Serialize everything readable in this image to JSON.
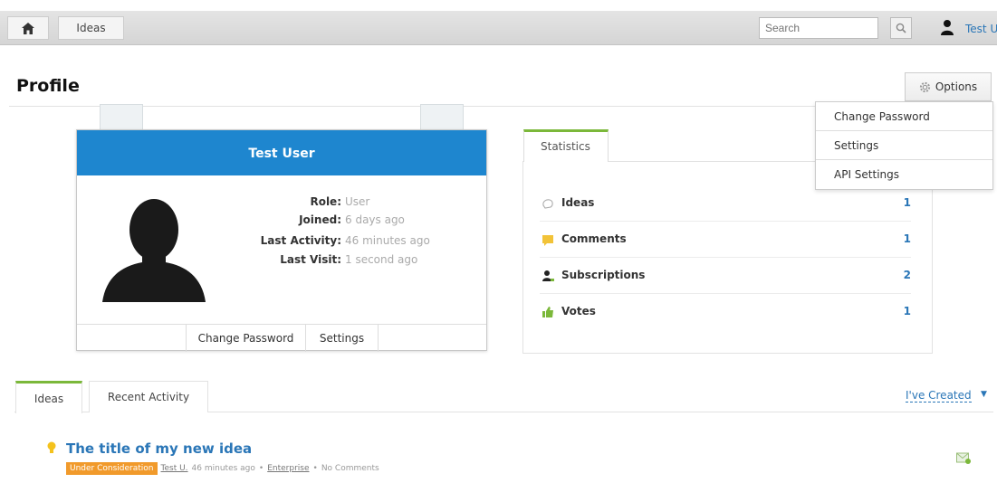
{
  "topbar": {
    "home_icon": "home-icon",
    "breadcrumb": "Ideas",
    "search_placeholder": "Search",
    "search_icon": "magnifier-icon",
    "user_icon": "user-silhouette-icon",
    "user_name": "Test U"
  },
  "page": {
    "title": "Profile",
    "options_label": "Options",
    "options_icon": "gear-icon",
    "dropdown": [
      "Change Password",
      "Settings",
      "API Settings"
    ]
  },
  "profile": {
    "name": "Test User",
    "fields": [
      {
        "label": "Role:",
        "value": "User"
      },
      {
        "label": "Joined:",
        "value": "6 days ago"
      },
      {
        "label": "Last Activity:",
        "value": "46 minutes ago"
      },
      {
        "label": "Last Visit:",
        "value": "1 second ago"
      }
    ],
    "buttons": [
      "Change Password",
      "Settings"
    ]
  },
  "statistics": {
    "tab_label": "Statistics",
    "rows": [
      {
        "icon": "bulb-outline-icon",
        "label": "Ideas",
        "value": "1"
      },
      {
        "icon": "comment-icon",
        "label": "Comments",
        "value": "1"
      },
      {
        "icon": "subscriber-icon",
        "label": "Subscriptions",
        "value": "2"
      },
      {
        "icon": "thumbs-up-icon",
        "label": "Votes",
        "value": "1"
      }
    ]
  },
  "bottom": {
    "tabs": [
      "Ideas",
      "Recent Activity"
    ],
    "filter_label": "I've Created",
    "idea": {
      "title": "The title of my new idea",
      "status": "Under Consideration",
      "author": "Test U.",
      "time": "46 minutes ago",
      "category": "Enterprise",
      "comments": "No Comments"
    }
  },
  "colors": {
    "accent_blue": "#1e86cf",
    "link_blue": "#2a76b7",
    "tab_green": "#7bb83a",
    "status_orange": "#f19a2b"
  }
}
